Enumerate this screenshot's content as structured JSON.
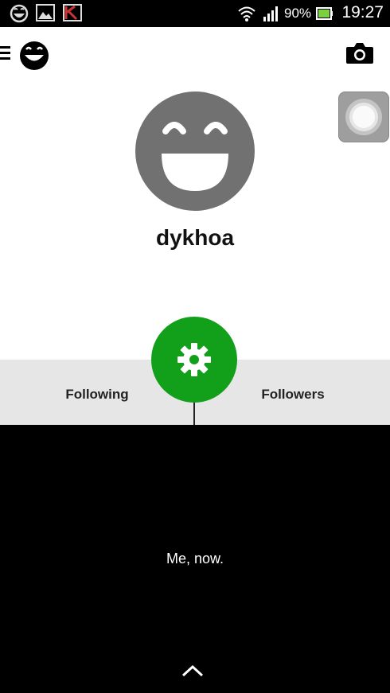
{
  "status_bar": {
    "battery_percent": "90%",
    "time": "19:27",
    "icons": [
      "smiley-notification-icon",
      "gallery-icon",
      "antivirus-icon",
      "wifi-icon",
      "signal-icon",
      "battery-icon"
    ]
  },
  "app_bar": {
    "icons": [
      "menu-icon",
      "app-logo-icon",
      "camera-icon"
    ]
  },
  "profile": {
    "username": "dykhoa"
  },
  "tabs": {
    "following_label": "Following",
    "followers_label": "Followers"
  },
  "status_panel": {
    "caption": "Me, now."
  },
  "colors": {
    "accent": "#12a01b",
    "avatar": "#717171",
    "tab_background": "#e6e6e6"
  }
}
